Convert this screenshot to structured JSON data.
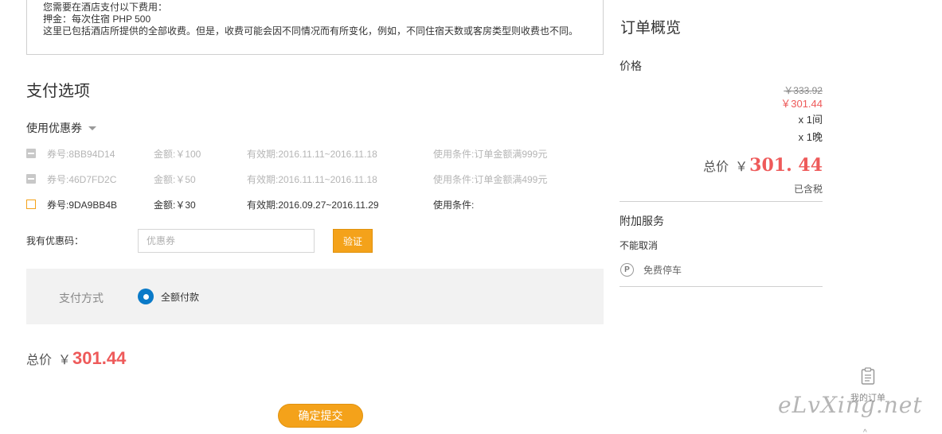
{
  "fee_notice": {
    "line1": "您需要在酒店支付以下费用：",
    "line2": "押金：每次住宿 PHP 500",
    "line3": "这里已包括酒店所提供的全部收费。但是，收费可能会因不同情况而有所变化，例如，不同住宿天数或客房类型则收费也不同。"
  },
  "payment": {
    "section_title": "支付选项",
    "coupon_toggle": "使用优惠券",
    "coupons": [
      {
        "code": "券号:8BB94D14",
        "amount": "金额:￥100",
        "valid": "有效期:2016.11.11~2016.11.18",
        "condition": "使用条件:订单金额满999元"
      },
      {
        "code": "券号:46D7FD2C",
        "amount": "金额:￥50",
        "valid": "有效期:2016.11.11~2016.11.18",
        "condition": "使用条件:订单金额满499元"
      },
      {
        "code": "券号:9DA9BB4B",
        "amount": "金额:￥30",
        "valid": "有效期:2016.09.27~2016.11.29",
        "condition": "使用条件:"
      }
    ],
    "promo_label": "我有优惠码：",
    "promo_placeholder": "优惠券",
    "verify_label": "验证",
    "method_label": "支付方式",
    "method_option": "全额付款",
    "total_label": "总价",
    "currency": "￥",
    "total_value": "301.44",
    "submit_label": "确定提交"
  },
  "summary": {
    "title": "订单概览",
    "price_label": "价格",
    "original_price": "￥333.92",
    "discount_price": "￥301.44",
    "rooms": "x 1间",
    "nights": "x 1晚",
    "total_label": "总价",
    "currency": "￥",
    "total_value": "301. 44",
    "tax_note": "已含税",
    "extra_title": "附加服务",
    "no_cancel": "不能取消",
    "parking_icon": "P",
    "parking": "免费停车"
  },
  "widget": {
    "my_orders": "我的订单",
    "up_arrow": "^"
  },
  "watermark": "eLvXing.net",
  "colors": {
    "accent_orange": "#f4a21a",
    "price_red": "#ee5a5a",
    "radio_blue": "#0a7ac8"
  }
}
